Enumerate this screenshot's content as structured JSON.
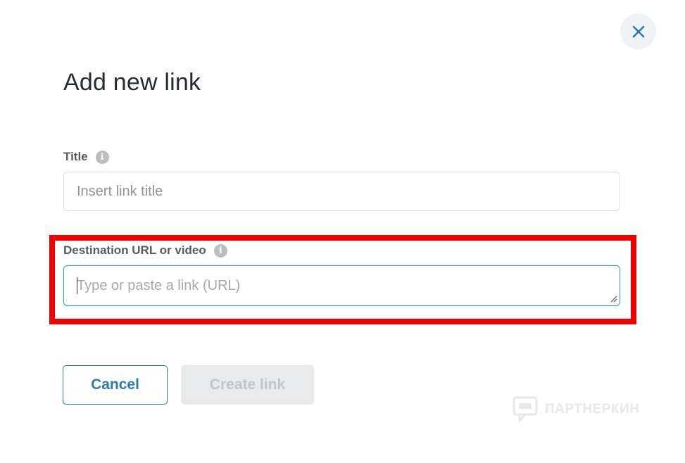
{
  "dialog": {
    "title": "Add new link",
    "close_icon": "close-icon"
  },
  "fields": {
    "title": {
      "label": "Title",
      "placeholder": "Insert link title",
      "value": "",
      "icon": "info-icon"
    },
    "url": {
      "label": "Destination URL or video",
      "placeholder": "Type or paste a link (URL)",
      "value": "",
      "icon": "info-icon"
    }
  },
  "actions": {
    "cancel_label": "Cancel",
    "create_label": "Create link"
  },
  "watermark": {
    "text": "ПАРТНЕРКИН"
  },
  "colors": {
    "accent": "#2b7ab4",
    "highlight": "#f20000",
    "disabled_bg": "#e9eaeb"
  }
}
